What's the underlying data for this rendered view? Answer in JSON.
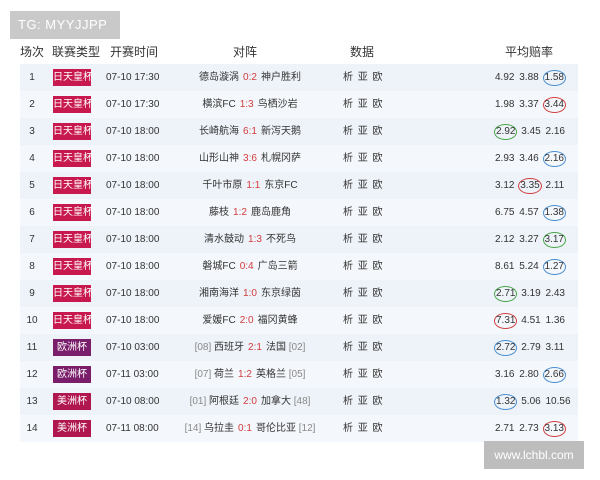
{
  "watermark_top": "TG: MYYJJPP",
  "watermark_bottom": "www.lchbl.com",
  "headers": {
    "no": "场次",
    "league": "联赛类型",
    "time": "开赛时间",
    "match": "对阵",
    "data": "数据",
    "odds": "平均赔率"
  },
  "colors": {
    "emperor": "#c8194f",
    "euro": "#7a1e6b",
    "america": "#b0174e",
    "score": "#d23c3c",
    "circle_blue": "#4a8fd1",
    "circle_red": "#d04040",
    "circle_green": "#4aa64a"
  },
  "data_label": "析 亚 欧",
  "rows": [
    {
      "no": "1",
      "league": "日天皇杯",
      "league_color": "#c8194f",
      "time": "07-10 17:30",
      "home": "德岛漩涡",
      "home_rank": "",
      "score": "0:2",
      "away": "神户胜利",
      "away_rank": "",
      "odds": [
        "4.92",
        "3.88",
        "1.58"
      ],
      "circle": [
        2,
        "#4a8fd1"
      ]
    },
    {
      "no": "2",
      "league": "日天皇杯",
      "league_color": "#c8194f",
      "time": "07-10 17:30",
      "home": "横滨FC",
      "home_rank": "",
      "score": "1:3",
      "away": "鸟栖沙岩",
      "away_rank": "",
      "odds": [
        "1.98",
        "3.37",
        "3.44"
      ],
      "circle": [
        2,
        "#d04040"
      ]
    },
    {
      "no": "3",
      "league": "日天皇杯",
      "league_color": "#c8194f",
      "time": "07-10 18:00",
      "home": "长崎航海",
      "home_rank": "",
      "score": "6:1",
      "away": "新泻天鹅",
      "away_rank": "",
      "odds": [
        "2.92",
        "3.45",
        "2.16"
      ],
      "circle": [
        0,
        "#4aa64a"
      ]
    },
    {
      "no": "4",
      "league": "日天皇杯",
      "league_color": "#c8194f",
      "time": "07-10 18:00",
      "home": "山形山神",
      "home_rank": "",
      "score": "3:6",
      "away": "札幌冈萨",
      "away_rank": "",
      "odds": [
        "2.93",
        "3.46",
        "2.16"
      ],
      "circle": [
        2,
        "#4a8fd1"
      ]
    },
    {
      "no": "5",
      "league": "日天皇杯",
      "league_color": "#c8194f",
      "time": "07-10 18:00",
      "home": "千叶市原",
      "home_rank": "",
      "score": "1:1",
      "away": "东京FC",
      "away_rank": "",
      "odds": [
        "3.12",
        "3.35",
        "2.11"
      ],
      "circle": [
        1,
        "#d04040"
      ]
    },
    {
      "no": "6",
      "league": "日天皇杯",
      "league_color": "#c8194f",
      "time": "07-10 18:00",
      "home": "藤枝",
      "home_rank": "",
      "score": "1:2",
      "away": "鹿岛鹿角",
      "away_rank": "",
      "odds": [
        "6.75",
        "4.57",
        "1.38"
      ],
      "circle": [
        2,
        "#4a8fd1"
      ]
    },
    {
      "no": "7",
      "league": "日天皇杯",
      "league_color": "#c8194f",
      "time": "07-10 18:00",
      "home": "清水鼓动",
      "home_rank": "",
      "score": "1:3",
      "away": "不死鸟",
      "away_rank": "",
      "odds": [
        "2.12",
        "3.27",
        "3.17"
      ],
      "circle": [
        2,
        "#4aa64a"
      ]
    },
    {
      "no": "8",
      "league": "日天皇杯",
      "league_color": "#c8194f",
      "time": "07-10 18:00",
      "home": "磐城FC",
      "home_rank": "",
      "score": "0:4",
      "away": "广岛三箭",
      "away_rank": "",
      "odds": [
        "8.61",
        "5.24",
        "1.27"
      ],
      "circle": [
        2,
        "#4a8fd1"
      ]
    },
    {
      "no": "9",
      "league": "日天皇杯",
      "league_color": "#c8194f",
      "time": "07-10 18:00",
      "home": "湘南海洋",
      "home_rank": "",
      "score": "1:0",
      "away": "东京绿茵",
      "away_rank": "",
      "odds": [
        "2.71",
        "3.19",
        "2.43"
      ],
      "circle": [
        0,
        "#4aa64a"
      ]
    },
    {
      "no": "10",
      "league": "日天皇杯",
      "league_color": "#c8194f",
      "time": "07-10 18:00",
      "home": "爱媛FC",
      "home_rank": "",
      "score": "2:0",
      "away": "福冈黄蜂",
      "away_rank": "",
      "odds": [
        "7.31",
        "4.51",
        "1.36"
      ],
      "circle": [
        0,
        "#d04040"
      ]
    },
    {
      "no": "11",
      "league": "欧洲杯",
      "league_color": "#7a1e6b",
      "time": "07-10 03:00",
      "home": "西班牙",
      "home_rank": "[08]",
      "score": "2:1",
      "away": "法国",
      "away_rank": "[02]",
      "odds": [
        "2.72",
        "2.79",
        "3.11"
      ],
      "circle": [
        0,
        "#4a8fd1"
      ]
    },
    {
      "no": "12",
      "league": "欧洲杯",
      "league_color": "#7a1e6b",
      "time": "07-11 03:00",
      "home": "荷兰",
      "home_rank": "[07]",
      "score": "1:2",
      "away": "英格兰",
      "away_rank": "[05]",
      "odds": [
        "3.16",
        "2.80",
        "2.66"
      ],
      "circle": [
        2,
        "#4a8fd1"
      ]
    },
    {
      "no": "13",
      "league": "美洲杯",
      "league_color": "#b0174e",
      "time": "07-10 08:00",
      "home": "阿根廷",
      "home_rank": "[01]",
      "score": "2:0",
      "away": "加拿大",
      "away_rank": "[48]",
      "odds": [
        "1.32",
        "5.06",
        "10.56"
      ],
      "circle": [
        0,
        "#4a8fd1"
      ]
    },
    {
      "no": "14",
      "league": "美洲杯",
      "league_color": "#b0174e",
      "time": "07-11 08:00",
      "home": "乌拉圭",
      "home_rank": "[14]",
      "score": "0:1",
      "away": "哥伦比亚",
      "away_rank": "[12]",
      "odds": [
        "2.71",
        "2.73",
        "3.13"
      ],
      "circle": [
        2,
        "#d04040"
      ]
    }
  ]
}
